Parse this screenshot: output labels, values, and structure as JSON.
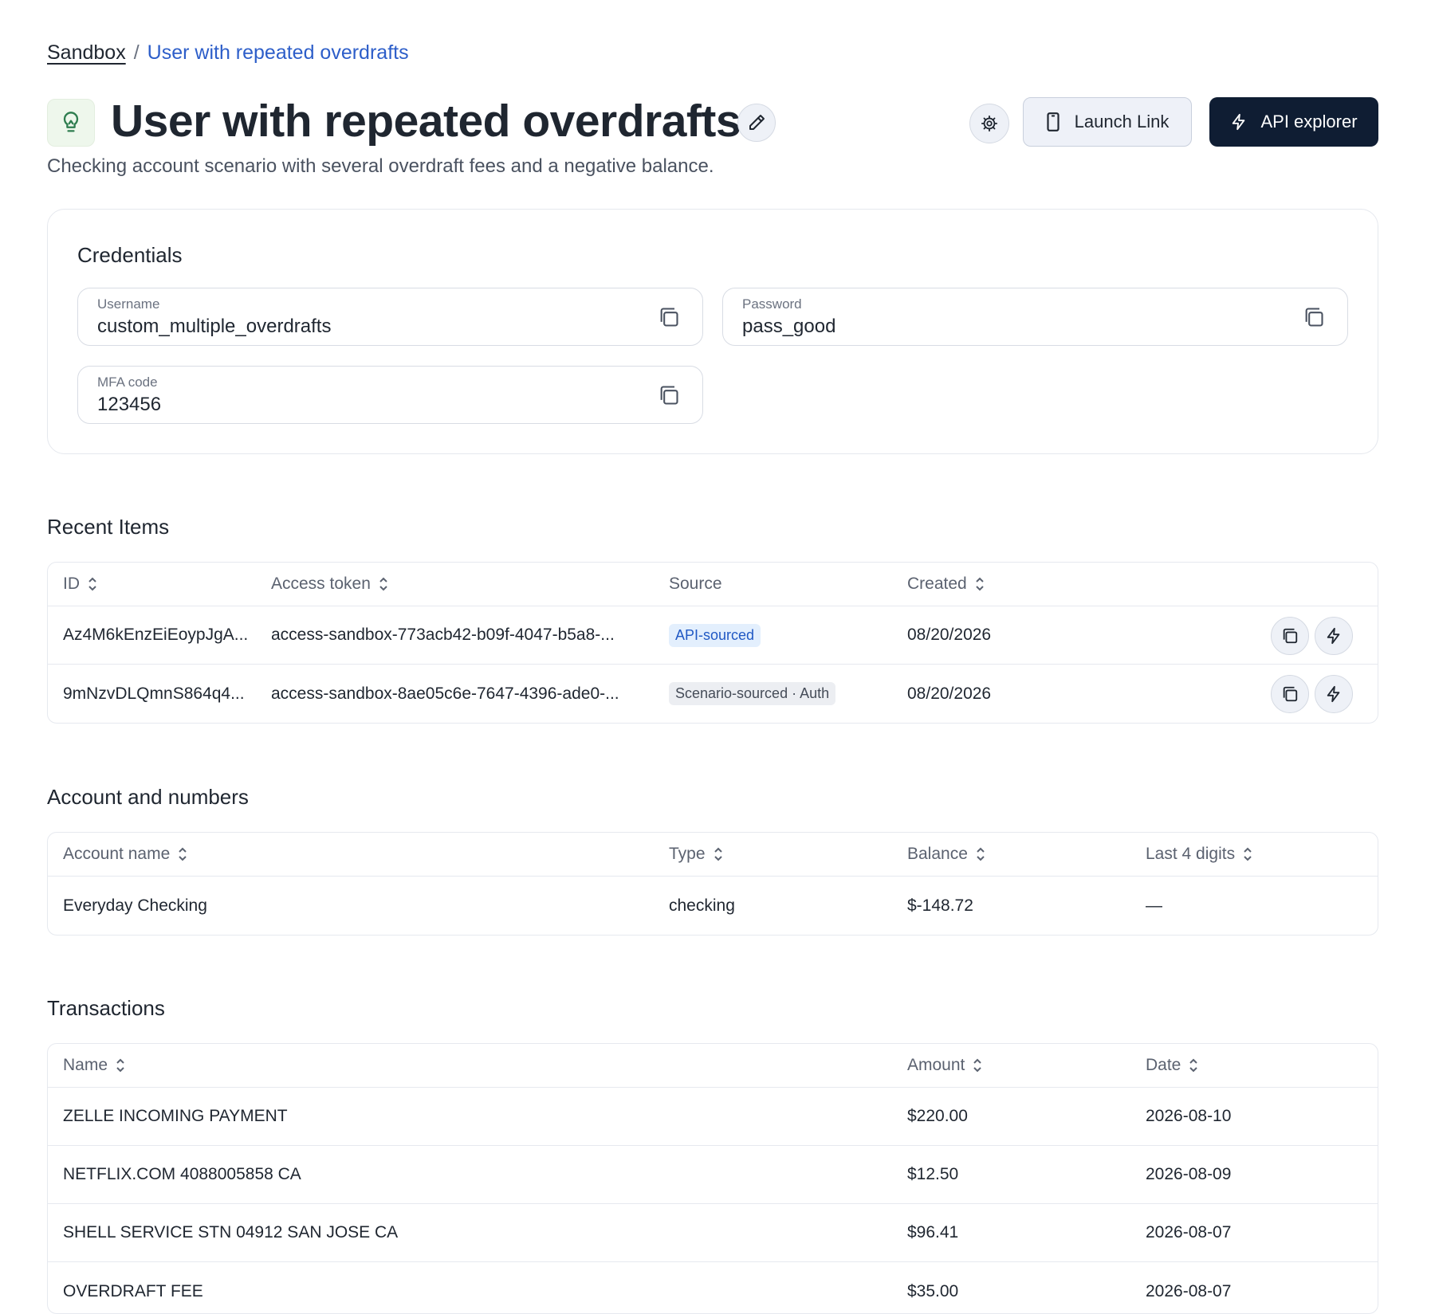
{
  "breadcrumb": {
    "root": "Sandbox",
    "separator": "/",
    "current": "User with repeated overdrafts"
  },
  "header": {
    "title": "User with repeated overdrafts",
    "subtitle": "Checking account scenario with several overdraft fees and a negative balance.",
    "launch_label": "Launch Link",
    "api_label": "API explorer"
  },
  "credentials": {
    "title": "Credentials",
    "username": {
      "label": "Username",
      "value": "custom_multiple_overdrafts"
    },
    "password": {
      "label": "Password",
      "value": "pass_good"
    },
    "mfa": {
      "label": "MFA code",
      "value": "123456"
    }
  },
  "recent_items": {
    "title": "Recent Items",
    "columns": {
      "id": "ID",
      "token": "Access token",
      "source": "Source",
      "created": "Created"
    },
    "rows": [
      {
        "id": "Az4M6kEnzEiEoypJgA...",
        "token": "access-sandbox-773acb42-b09f-4047-b5a8-...",
        "source": "API-sourced",
        "created": "08/20/2026"
      },
      {
        "id": "9mNzvDLQmnS864q4...",
        "token": "access-sandbox-8ae05c6e-7647-4396-ade0-...",
        "source": "Scenario-sourced · Auth",
        "created": "08/20/2026"
      }
    ]
  },
  "accounts": {
    "title": "Account and numbers",
    "columns": {
      "name": "Account name",
      "type": "Type",
      "balance": "Balance",
      "last4": "Last 4 digits"
    },
    "rows": [
      {
        "name": "Everyday Checking",
        "type": "checking",
        "balance": "$-148.72",
        "last4": "—"
      }
    ]
  },
  "transactions": {
    "title": "Transactions",
    "columns": {
      "name": "Name",
      "amount": "Amount",
      "date": "Date"
    },
    "rows": [
      {
        "name": "ZELLE INCOMING PAYMENT",
        "amount": "$220.00",
        "date": "2026-08-10"
      },
      {
        "name": "NETFLIX.COM 4088005858 CA",
        "amount": "$12.50",
        "date": "2026-08-09"
      },
      {
        "name": "SHELL SERVICE STN 04912 SAN JOSE CA",
        "amount": "$96.41",
        "date": "2026-08-07"
      },
      {
        "name": "OVERDRAFT FEE",
        "amount": "$35.00",
        "date": "2026-08-07"
      }
    ]
  },
  "colors": {
    "accent": "#2d5ec9",
    "primary_button": "#0f1d33",
    "badge_api_bg": "#e3effd",
    "badge_api_text": "#2058c4",
    "icon_green": "#2e7d4f"
  }
}
